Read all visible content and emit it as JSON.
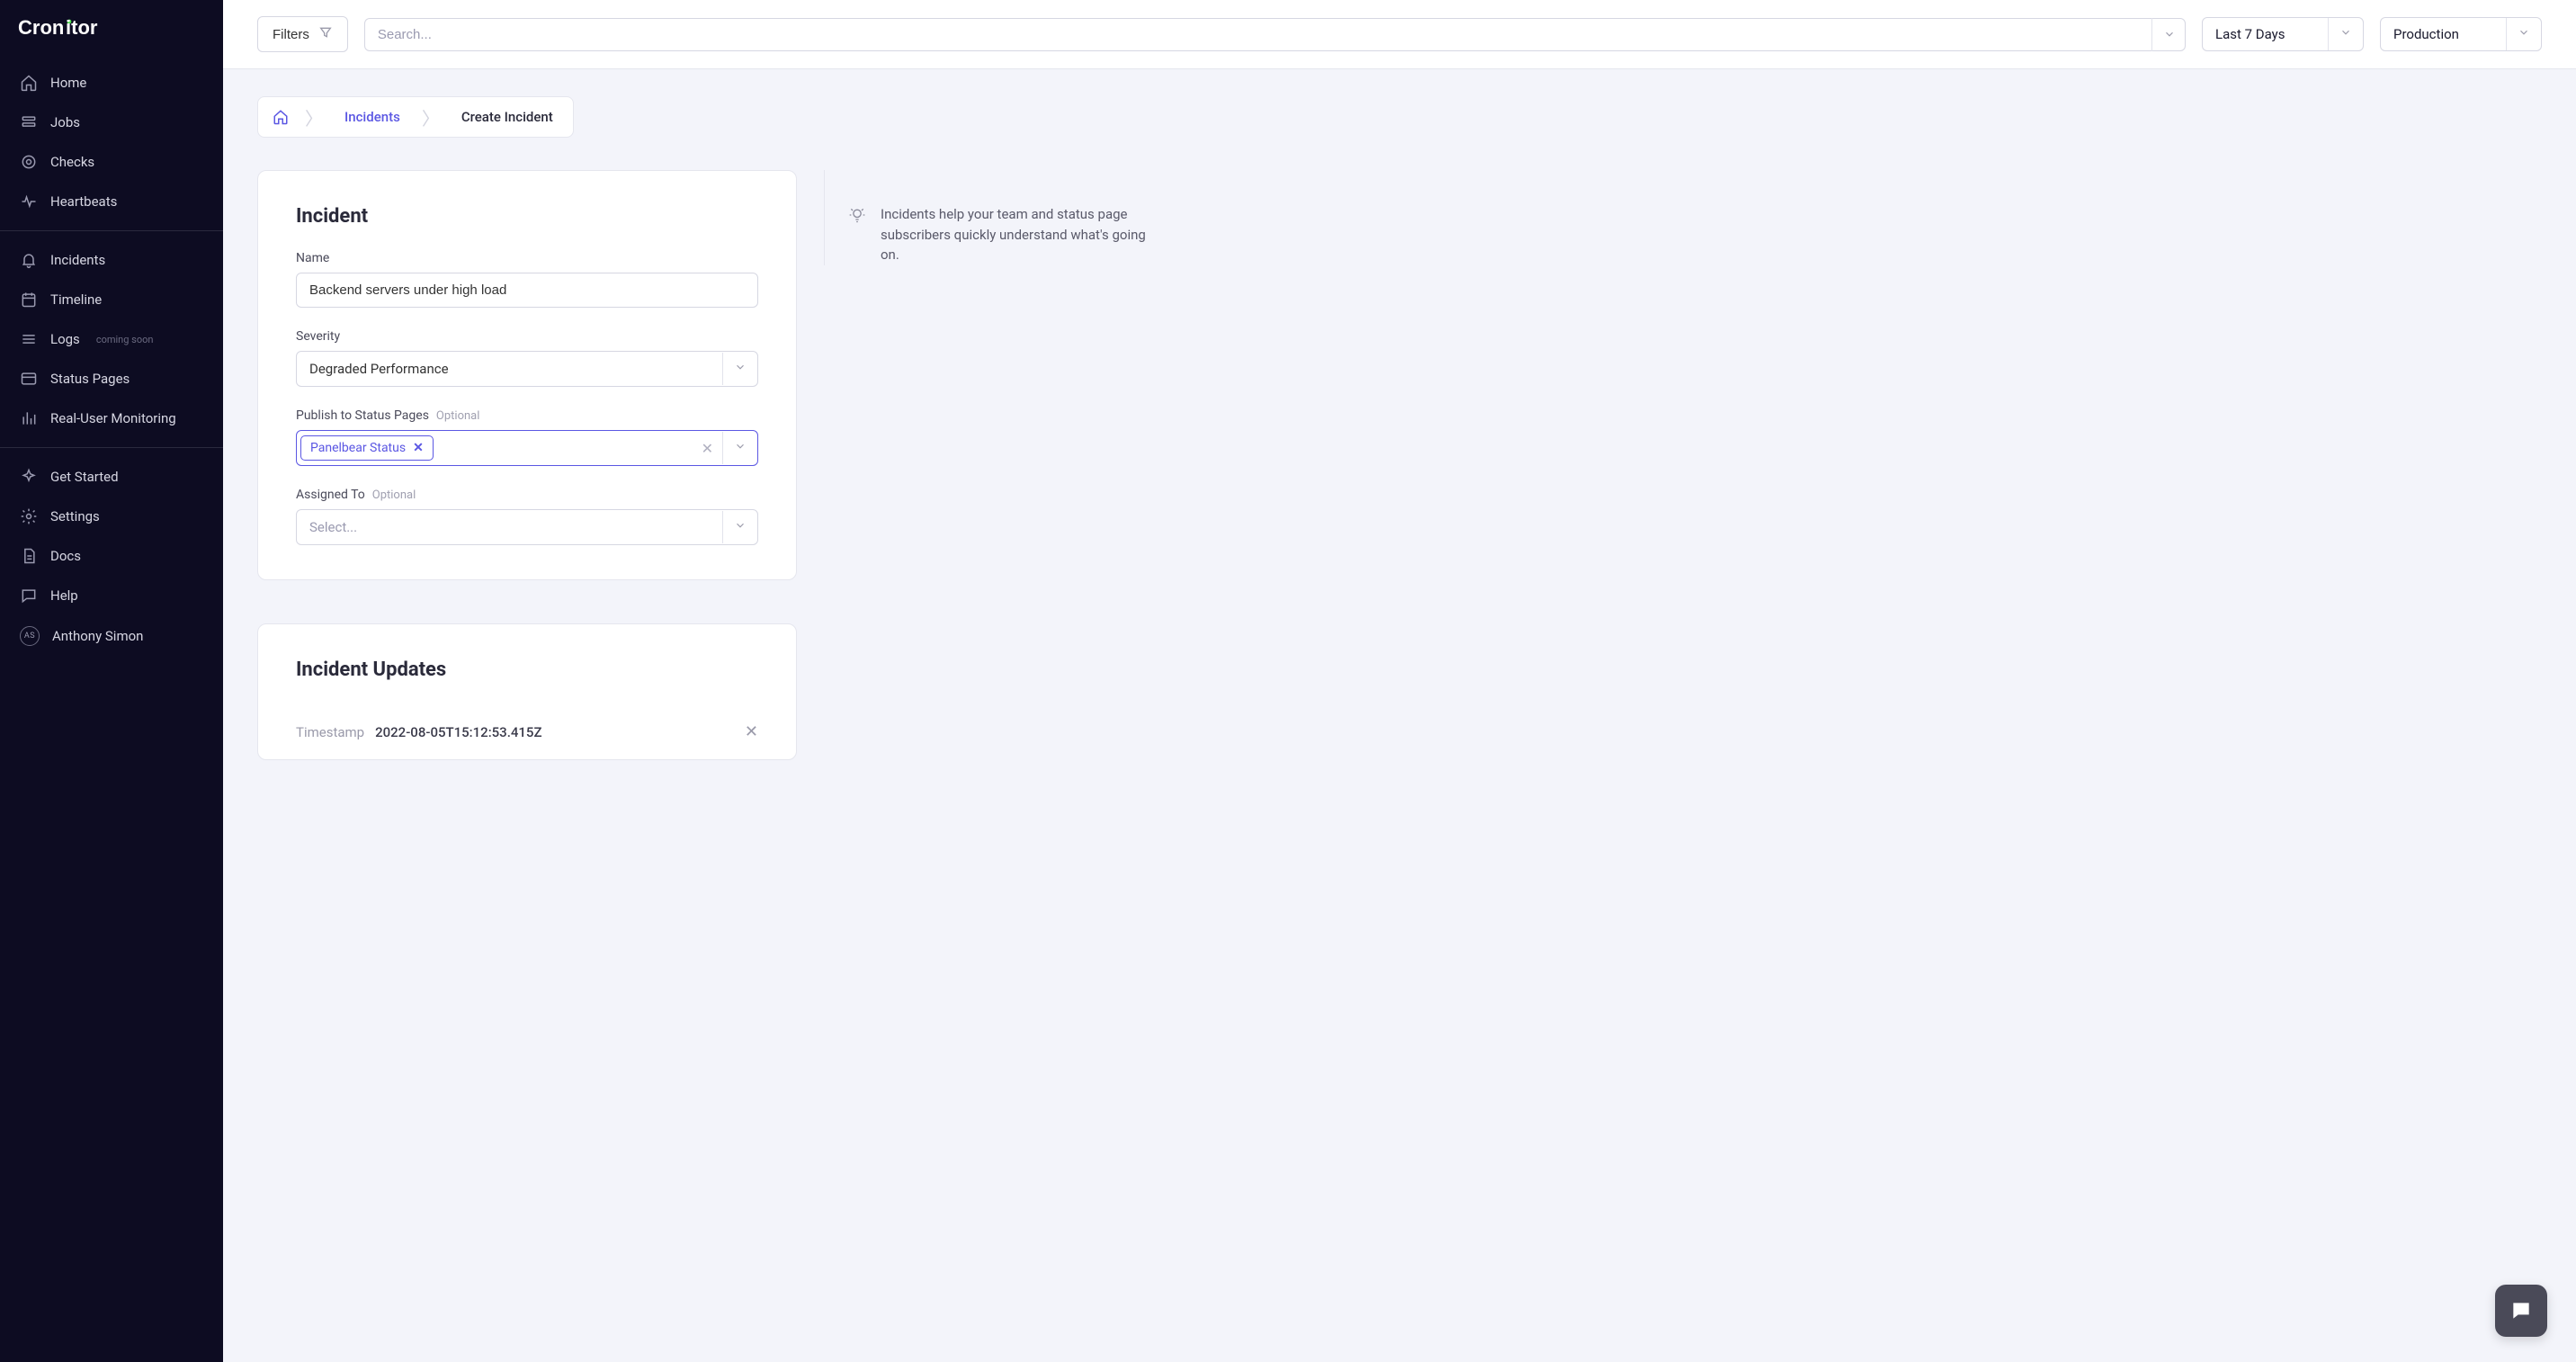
{
  "brand": "Cronitor",
  "sidebar": {
    "group1": [
      {
        "label": "Home",
        "icon": "home"
      },
      {
        "label": "Jobs",
        "icon": "jobs"
      },
      {
        "label": "Checks",
        "icon": "checks"
      },
      {
        "label": "Heartbeats",
        "icon": "heartbeats"
      }
    ],
    "group2": [
      {
        "label": "Incidents",
        "icon": "bell"
      },
      {
        "label": "Timeline",
        "icon": "calendar"
      },
      {
        "label": "Logs",
        "icon": "list",
        "badge": "coming soon"
      },
      {
        "label": "Status Pages",
        "icon": "window"
      },
      {
        "label": "Real-User Monitoring",
        "icon": "bars"
      }
    ],
    "group3": [
      {
        "label": "Get Started",
        "icon": "sparkle"
      },
      {
        "label": "Settings",
        "icon": "gear"
      },
      {
        "label": "Docs",
        "icon": "doc"
      },
      {
        "label": "Help",
        "icon": "chat"
      }
    ],
    "user": {
      "label": "Anthony Simon",
      "initials": "AS"
    }
  },
  "topbar": {
    "filters_label": "Filters",
    "search_placeholder": "Search...",
    "range_value": "Last 7 Days",
    "env_value": "Production"
  },
  "breadcrumb": {
    "incidents": "Incidents",
    "create": "Create Incident"
  },
  "form": {
    "heading": "Incident",
    "name_label": "Name",
    "name_value": "Backend servers under high load",
    "severity_label": "Severity",
    "severity_value": "Degraded Performance",
    "publish_label": "Publish to Status Pages",
    "optional": "Optional",
    "publish_tag": "Panelbear Status",
    "assigned_label": "Assigned To",
    "assigned_placeholder": "Select..."
  },
  "hint": "Incidents help your team and status page subscribers quickly understand what's going on.",
  "updates": {
    "heading": "Incident Updates",
    "timestamp_label": "Timestamp",
    "timestamp_value": "2022-08-05T15:12:53.415Z"
  }
}
